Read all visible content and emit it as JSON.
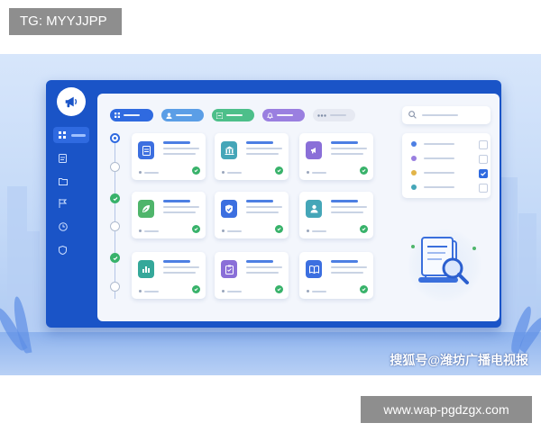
{
  "top_tag": "TG: MYYJJPP",
  "watermark": "搜狐号@潍坊广播电视报",
  "bottom_url": "www.wap-pgdzgx.com",
  "colors": {
    "accent": "#1a54c7",
    "sidebar_active": "#2f6ae0",
    "success": "#38b26a",
    "tab_colors": [
      "#2f6ae0",
      "#5b9ee6",
      "#4dbf8a",
      "#9a7fe0",
      "#e6e9f2"
    ]
  },
  "sidebar": {
    "logo_icon": "megaphone-icon",
    "items": [
      {
        "icon": "grid-icon",
        "active": true
      },
      {
        "icon": "document-icon",
        "active": false
      },
      {
        "icon": "folder-icon",
        "active": false
      },
      {
        "icon": "flag-icon",
        "active": false
      },
      {
        "icon": "clock-icon",
        "active": false
      },
      {
        "icon": "shield-icon",
        "active": false
      }
    ]
  },
  "tabs": [
    {
      "icon": "grid-icon",
      "active": true
    },
    {
      "icon": "user-icon",
      "active": false
    },
    {
      "icon": "list-icon",
      "active": false
    },
    {
      "icon": "bell-icon",
      "active": false
    },
    {
      "icon": "more-icon",
      "active": false
    }
  ],
  "steps": [
    "current",
    "pending",
    "done",
    "pending",
    "done",
    "pending"
  ],
  "cards": [
    {
      "icon": "document-icon",
      "color": "#3c6fe0",
      "verified": true
    },
    {
      "icon": "building-icon",
      "color": "#45a6b8",
      "verified": true
    },
    {
      "icon": "megaphone-icon",
      "color": "#8a6fd8",
      "verified": true
    },
    {
      "icon": "leaf-icon",
      "color": "#4fb56b",
      "verified": true
    },
    {
      "icon": "shield-check-icon",
      "color": "#3c6fe0",
      "verified": true
    },
    {
      "icon": "person-card-icon",
      "color": "#45a6b8",
      "verified": true
    },
    {
      "icon": "bar-chart-icon",
      "color": "#35a89a",
      "verified": true
    },
    {
      "icon": "clipboard-icon",
      "color": "#8a6fd8",
      "verified": true
    },
    {
      "icon": "book-icon",
      "color": "#3c6fe0",
      "verified": true
    }
  ],
  "right_panel": {
    "search_icon": "search-icon",
    "filters": [
      {
        "color": "#4d7fe3",
        "checked": false
      },
      {
        "color": "#9a7fe0",
        "checked": false
      },
      {
        "color": "#e2b448",
        "checked": true
      },
      {
        "color": "#45a6b8",
        "checked": false
      }
    ],
    "illustration_icon": "document-magnifier-icon"
  }
}
